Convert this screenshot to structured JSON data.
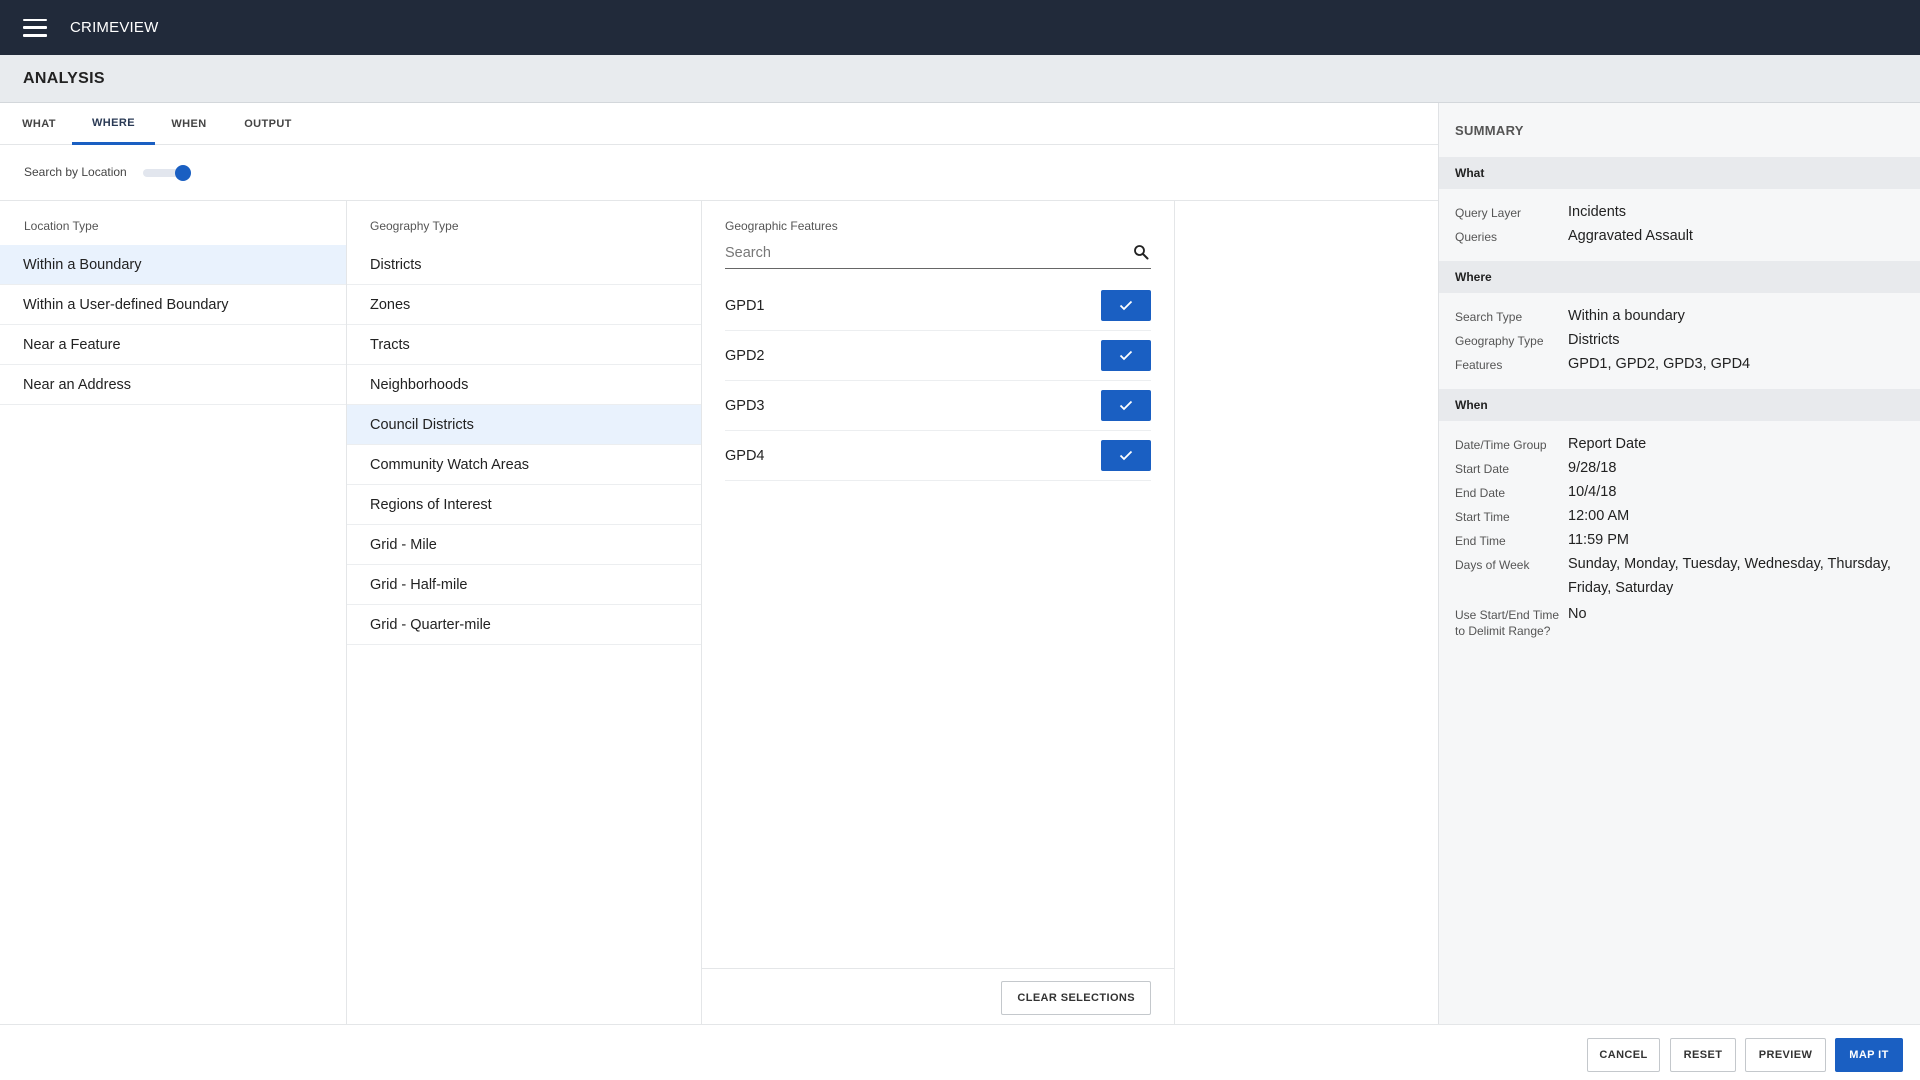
{
  "app": {
    "title": "CRIMEVIEW"
  },
  "section": {
    "title": "ANALYSIS"
  },
  "tabs": [
    {
      "label": "WHAT"
    },
    {
      "label": "WHERE",
      "active": true
    },
    {
      "label": "WHEN"
    },
    {
      "label": "OUTPUT"
    }
  ],
  "toggle": {
    "label": "Search by Location",
    "on": true
  },
  "location_type": {
    "header": "Location Type",
    "items": [
      "Within a Boundary",
      "Within a User-defined Boundary",
      "Near a Feature",
      "Near an Address"
    ],
    "selected": "Within a Boundary"
  },
  "geography_type": {
    "header": "Geography Type",
    "items": [
      "Districts",
      "Zones",
      "Tracts",
      "Neighborhoods",
      "Council Districts",
      "Community Watch Areas",
      "Regions of Interest",
      "Grid - Mile",
      "Grid - Half-mile",
      "Grid - Quarter-mile"
    ],
    "selected": "Council Districts"
  },
  "geographic_features": {
    "header": "Geographic Features",
    "search_placeholder": "Search",
    "items": [
      {
        "label": "GPD1",
        "checked": true
      },
      {
        "label": "GPD2",
        "checked": true
      },
      {
        "label": "GPD3",
        "checked": true
      },
      {
        "label": "GPD4",
        "checked": true
      }
    ],
    "clear_label": "CLEAR SELECTIONS"
  },
  "summary": {
    "title": "SUMMARY",
    "what": {
      "header": "What",
      "rows": [
        {
          "key": "Query Layer",
          "value": "Incidents"
        },
        {
          "key": "Queries",
          "value": "Aggravated Assault"
        }
      ]
    },
    "where": {
      "header": "Where",
      "rows": [
        {
          "key": "Search Type",
          "value": "Within a boundary"
        },
        {
          "key": "Geography Type",
          "value": "Districts"
        },
        {
          "key": "Features",
          "value": "GPD1, GPD2, GPD3, GPD4"
        }
      ]
    },
    "when": {
      "header": "When",
      "rows": [
        {
          "key": "Date/Time Group",
          "value": "Report Date"
        },
        {
          "key": "Start Date",
          "value": "9/28/18"
        },
        {
          "key": "End Date",
          "value": "10/4/18"
        },
        {
          "key": "Start Time",
          "value": "12:00 AM"
        },
        {
          "key": "End Time",
          "value": "11:59 PM"
        },
        {
          "key": "Days of Week",
          "value": "Sunday, Monday, Tuesday, Wednesday, Thursday, Friday, Saturday"
        },
        {
          "key": "Use Start/End Time to Delimit Range?",
          "value": "No"
        }
      ]
    }
  },
  "footer": {
    "cancel": "CANCEL",
    "reset": "RESET",
    "preview": "PREVIEW",
    "map_it": "MAP IT"
  },
  "colors": {
    "accent": "#1a5fc2",
    "topbar": "#212a3a",
    "selected_row": "#e9f2fd"
  },
  "icons": {
    "menu": "hamburger-icon",
    "search": "search-icon",
    "check": "check-icon"
  }
}
